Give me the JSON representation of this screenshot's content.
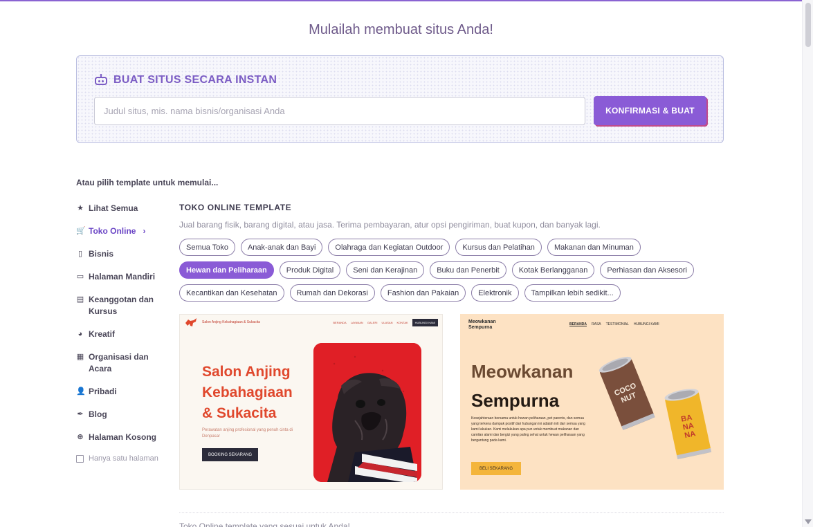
{
  "page_title": "Mulailah membuat situs Anda!",
  "instant": {
    "title": "BUAT SITUS SECARA INSTAN",
    "icon": "robot-icon",
    "input_placeholder": "Judul situs, mis. nama bisnis/organisasi Anda",
    "input_value": "",
    "confirm_label": "KONFIRMASI & BUAT"
  },
  "pick_label": "Atau pilih template untuk memulai...",
  "sidebar": {
    "items": [
      {
        "label": "Lihat Semua",
        "icon": "star-icon",
        "glyph": "★"
      },
      {
        "label": "Toko Online",
        "icon": "cart-icon",
        "glyph": "🛒",
        "active": true
      },
      {
        "label": "Bisnis",
        "icon": "clipboard-icon",
        "glyph": "▯"
      },
      {
        "label": "Halaman Mandiri",
        "icon": "window-icon",
        "glyph": "▭"
      },
      {
        "label": "Keanggotan dan Kursus",
        "icon": "id-card-icon",
        "glyph": "▤"
      },
      {
        "label": "Kreatif",
        "icon": "palette-icon",
        "glyph": "◕"
      },
      {
        "label": "Organisasi dan Acara",
        "icon": "calendar-icon",
        "glyph": "▦"
      },
      {
        "label": "Pribadi",
        "icon": "user-icon",
        "glyph": "👤"
      },
      {
        "label": "Blog",
        "icon": "feather-icon",
        "glyph": "✒"
      },
      {
        "label": "Halaman Kosong",
        "icon": "plus-circle-icon",
        "glyph": "⊕"
      }
    ],
    "single_page_label": "Hanya satu halaman"
  },
  "category": {
    "title": "TOKO ONLINE TEMPLATE",
    "description": "Jual barang fisik, barang digital, atau jasa. Terima pembayaran, atur opsi pengiriman, buat kupon, dan banyak lagi.",
    "tags": [
      {
        "label": "Semua Toko"
      },
      {
        "label": "Anak-anak dan Bayi"
      },
      {
        "label": "Olahraga dan Kegiatan Outdoor"
      },
      {
        "label": "Kursus dan Pelatihan"
      },
      {
        "label": "Makanan dan Minuman"
      },
      {
        "label": "Hewan dan Peliharaan",
        "selected": true
      },
      {
        "label": "Produk Digital"
      },
      {
        "label": "Seni dan Kerajinan"
      },
      {
        "label": "Buku dan Penerbit"
      },
      {
        "label": "Kotak Berlangganan"
      },
      {
        "label": "Perhiasan dan Aksesori"
      },
      {
        "label": "Kecantikan dan Kesehatan"
      },
      {
        "label": "Rumah dan Dekorasi"
      },
      {
        "label": "Fashion dan Pakaian"
      },
      {
        "label": "Elektronik"
      },
      {
        "label": "Tampilkan lebih sedikit..."
      }
    ]
  },
  "templates": {
    "salon": {
      "brand": "Salon Anjing Kebahagiaan & Sukacita",
      "nav": [
        "BERANDA",
        "LAYANAN",
        "GALERI",
        "ULASAN",
        "KONTAK"
      ],
      "nav_button": "HUBUNGI KAMI",
      "headline_1": "Salon Anjing",
      "headline_2": "Kebahagiaan",
      "headline_3": "& Sukacita",
      "subtitle": "Perawatan anjing profesional yang penuh cinta di Denpasar",
      "cta": "BOOKING SEKARANG",
      "colors": {
        "accent": "#e0482d",
        "photo_bg": "#e01f26"
      }
    },
    "meow": {
      "brand_1": "Meowkanan",
      "brand_2": "Sempurna",
      "nav": [
        "BERANDA",
        "RASA",
        "TESTIMONIAL",
        "HUBUNGI KAMI"
      ],
      "headline_1": "Meowkanan",
      "headline_2": "Sempurna",
      "body": "Kesejahteraan bersama untuk hewan peliharaan, pet parents, dan semua yang terkena dampak positif dari hubungan ini adalah inti dari semua yang kami lakukan. Kami melakukan apa pun untuk membuat makanan dan camilan alami dan bergizi yang paling sehat untuk hewan peliharaan yang bergantung pada kami.",
      "cta": "BELI SEKARANG",
      "can1": "COCONUT",
      "can2": "BANANA",
      "colors": {
        "bg": "#fde2c3",
        "cta": "#f4b53c"
      }
    }
  },
  "footer_cutoff": "Toko Online template yang sesuai untuk Anda!"
}
